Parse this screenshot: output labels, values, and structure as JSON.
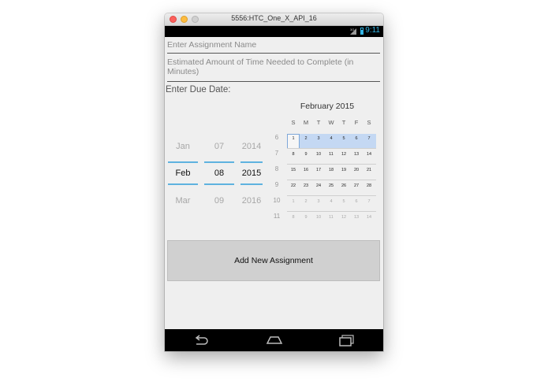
{
  "window": {
    "title": "5556:HTC_One_X_API_16"
  },
  "status_bar": {
    "time": "9:11",
    "network": "3G"
  },
  "form": {
    "name_placeholder": "Enter Assignment Name",
    "time_placeholder": "Estimated Amount of Time Needed to Complete (in Minutes)",
    "due_label": "Enter Due Date:"
  },
  "spinners": {
    "month": {
      "prev": "Jan",
      "current": "Feb",
      "next": "Mar"
    },
    "day": {
      "prev": "07",
      "current": "08",
      "next": "09"
    },
    "year": {
      "prev": "2014",
      "current": "2015",
      "next": "2016"
    }
  },
  "calendar": {
    "title": "February 2015",
    "weekdays": [
      "S",
      "M",
      "T",
      "W",
      "T",
      "F",
      "S"
    ],
    "weeks": [
      {
        "num": "6",
        "days": [
          "1",
          "2",
          "3",
          "4",
          "5",
          "6",
          "7"
        ]
      },
      {
        "num": "7",
        "days": [
          "8",
          "9",
          "10",
          "11",
          "12",
          "13",
          "14"
        ]
      },
      {
        "num": "8",
        "days": [
          "15",
          "16",
          "17",
          "18",
          "19",
          "20",
          "21"
        ]
      },
      {
        "num": "9",
        "days": [
          "22",
          "23",
          "24",
          "25",
          "26",
          "27",
          "28"
        ]
      },
      {
        "num": "10",
        "days": [
          "1",
          "2",
          "3",
          "4",
          "5",
          "6",
          "7"
        ]
      },
      {
        "num": "11",
        "days": [
          "8",
          "9",
          "10",
          "11",
          "12",
          "13",
          "14"
        ]
      }
    ],
    "selected_day": "8"
  },
  "add_button": {
    "label": "Add New Assignment"
  },
  "nav": {
    "back": "back-icon",
    "home": "home-icon",
    "recents": "recents-icon"
  }
}
